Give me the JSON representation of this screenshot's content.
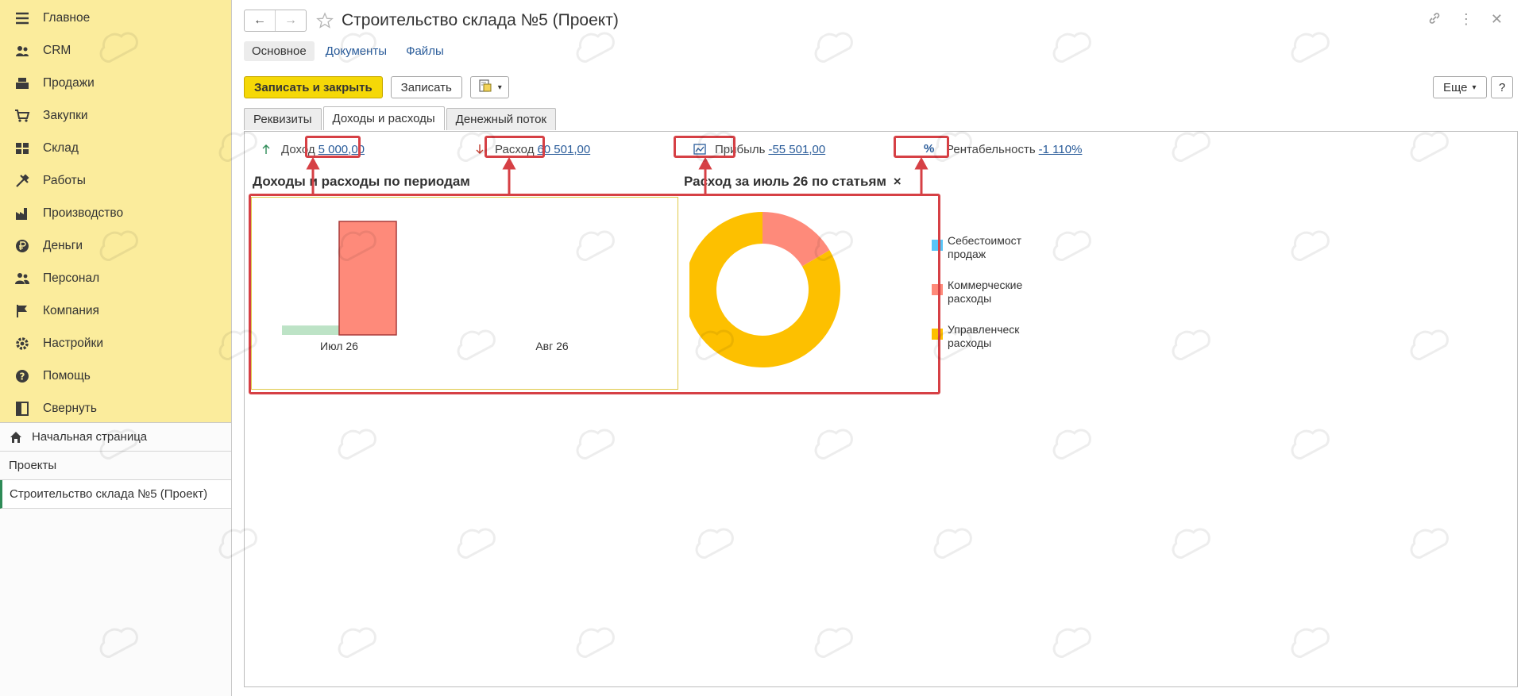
{
  "sidebar": {
    "menu": [
      {
        "label": "Главное",
        "icon": "menu-lines-icon"
      },
      {
        "label": "CRM",
        "icon": "crm-icon"
      },
      {
        "label": "Продажи",
        "icon": "cash-register-icon"
      },
      {
        "label": "Закупки",
        "icon": "cart-icon"
      },
      {
        "label": "Склад",
        "icon": "warehouse-icon"
      },
      {
        "label": "Работы",
        "icon": "tools-icon"
      },
      {
        "label": "Производство",
        "icon": "factory-icon"
      },
      {
        "label": "Деньги",
        "icon": "ruble-icon"
      },
      {
        "label": "Персонал",
        "icon": "people-icon"
      },
      {
        "label": "Компания",
        "icon": "flag-icon"
      },
      {
        "label": "Настройки",
        "icon": "gear-icon"
      },
      {
        "label": "Помощь",
        "icon": "help-icon"
      },
      {
        "label": "Свернуть",
        "icon": "collapse-icon"
      }
    ],
    "home_label": "Начальная страница",
    "projects_label": "Проекты",
    "active_label": "Строительство склада №5 (Проект)"
  },
  "window": {
    "title": "Строительство склада №5 (Проект)",
    "subtabs": [
      "Основное",
      "Документы",
      "Файлы"
    ]
  },
  "commands": {
    "save_close": "Записать и закрыть",
    "save": "Записать",
    "more": "Еще",
    "help": "?"
  },
  "form_tabs": [
    "Реквизиты",
    "Доходы и расходы",
    "Денежный поток"
  ],
  "kpis": {
    "income_label": "Доход",
    "income_value": "5 000,00",
    "expense_label": "Расход",
    "expense_value": "60 501,00",
    "profit_label": "Прибыль",
    "profit_value": "-55 501,00",
    "rent_label": "Рентабельность",
    "rent_value": "-1 110%"
  },
  "colors": {
    "income": "#bde3c6",
    "expense": "#fe8a7a",
    "cost": "#57c5f7",
    "commercial": "#fe8a7a",
    "management": "#fdc000",
    "highlight": "#d64045",
    "accent": "#f5d807"
  },
  "chart_data": [
    {
      "type": "bar",
      "title": "Доходы и расходы по периодам",
      "categories": [
        "Июл 26",
        "Авг 26"
      ],
      "series": [
        {
          "values": [
            5000,
            0
          ]
        },
        {
          "values": [
            60501,
            0
          ]
        }
      ]
    },
    {
      "type": "pie",
      "title": "Расход за июль 26 по статьям",
      "close_label": "×",
      "labels": [
        "Себестоимость продаж",
        "Коммерческие расходы",
        "Управленческие расходы"
      ],
      "legend_display": [
        [
          "Себестоимост",
          "продаж"
        ],
        [
          "Коммерческие",
          "расходы"
        ],
        [
          "Управленческ",
          "расходы"
        ]
      ],
      "values": [
        0,
        10000,
        50501
      ]
    }
  ]
}
